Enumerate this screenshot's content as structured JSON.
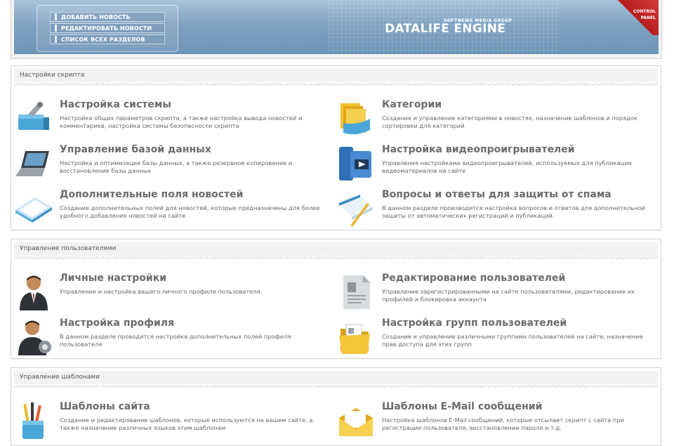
{
  "header": {
    "menu": [
      "ДОБАВИТЬ НОВОСТЬ",
      "РЕДАКТИРОВАТЬ НОВОСТИ",
      "СПИСОК ВСЕХ РАЗДЕЛОВ"
    ],
    "logo_sub": "SOFTNEWS MEDIA GROUP",
    "logo": "DATALIFE ENGINE",
    "corner_label_1": "CONTROL",
    "corner_label_2": "PANEL"
  },
  "sections": [
    {
      "title": "Настройки скрипта",
      "items": [
        {
          "title": "Настройка системы",
          "desc": "Настройка общих параметров скрипта, а также настройка вывода новостей и комментариев, настройка системы безопасности скрипта",
          "icon": "toolbox-icon"
        },
        {
          "title": "Категории",
          "desc": "Создание и управление категориями в новостях, назначение шаблонов и порядок сортировки для категорий",
          "icon": "folders-icon"
        },
        {
          "title": "Управление базой данных",
          "desc": "Настройка и оптимизация базы данных, а также резервное копирование и восстановление базы данных",
          "icon": "laptop-icon"
        },
        {
          "title": "Настройка видеопроигрывателей",
          "desc": "Управления настройками видеопроигрывателей, используемых для публикации видеоматериалов на сайте",
          "icon": "video-player-icon"
        },
        {
          "title": "Дополнительные поля новостей",
          "desc": "Создание дополнительных полей для новостей, которые предназначены для более удобного добавления новостей на сайте",
          "icon": "tray-icon"
        },
        {
          "title": "Вопросы и ответы для защиты от спама",
          "desc": "В данном разделе производится настройка вопросов и ответов для дополнительной защиты от автоматических регистраций и публикаций.",
          "icon": "notepad-pen-icon"
        }
      ]
    },
    {
      "title": "Управление пользователями",
      "items": [
        {
          "title": "Личные настройки",
          "desc": "Управление и настройка вашего личного профиля пользователя.",
          "icon": "user-icon"
        },
        {
          "title": "Редактирование пользователей",
          "desc": "Управление зарегистрированными на сайте пользователями, редактирование их профилей и блокировка аккаунта",
          "icon": "document-icon"
        },
        {
          "title": "Настройка профиля",
          "desc": "В данном разделе проводится настройка дополнительных полей профиля пользователя",
          "icon": "user-settings-icon"
        },
        {
          "title": "Настройка групп пользователей",
          "desc": "Создание и управление различными группами пользователей на сайте, назначение прав доступа для этих групп",
          "icon": "folder-icon"
        }
      ]
    },
    {
      "title": "Управление шаблонами",
      "items": [
        {
          "title": "Шаблоны сайта",
          "desc": "Создание и редактирование шаблонов, которые используются на вашем сайте, а также назначение различных языков этим шаблонам",
          "icon": "pencils-icon"
        },
        {
          "title": "Шаблоны E-Mail сообщений",
          "desc": "Настройка шаблонов E-Mail сообщений, которые отсылает скрипт с сайта при регистрации пользователя, восстановлении пароля и т.д.",
          "icon": "envelope-icon"
        }
      ]
    }
  ]
}
